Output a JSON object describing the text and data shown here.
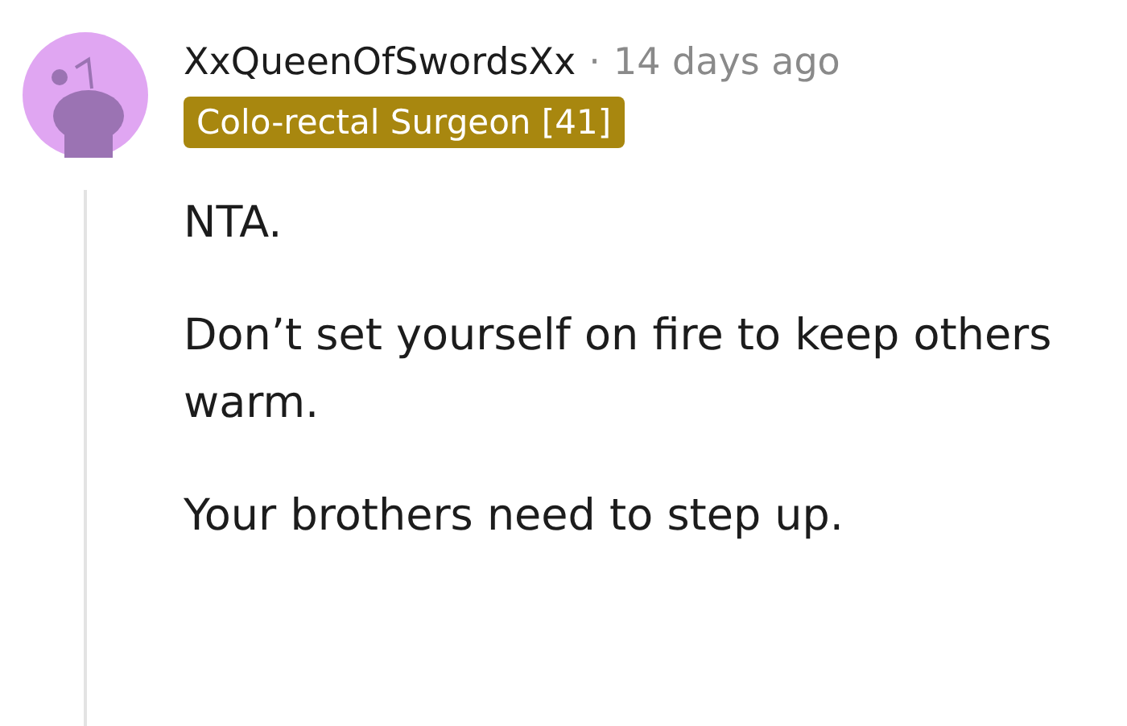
{
  "comment": {
    "author": "XxQueenOfSwordsXx",
    "separator": "·",
    "time": "14 days ago",
    "flair": {
      "text": "Colo-rectal Surgeon [41]",
      "color": "#a8870f"
    },
    "paragraphs": [
      "NTA.",
      "Don’t set yourself on fire to keep others warm.",
      "Your brothers need to step up."
    ]
  }
}
